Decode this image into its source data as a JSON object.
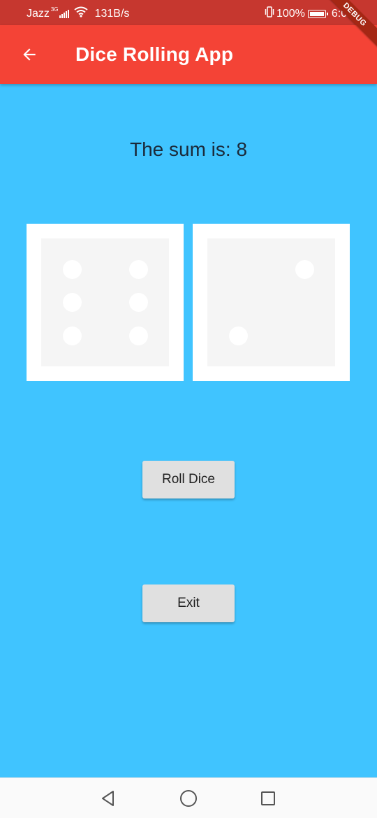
{
  "status_bar": {
    "carrier": "Jazz",
    "network_type": "3G",
    "speed": "131B/s",
    "battery": "100%",
    "time": "6:02",
    "icons": [
      "signal-icon",
      "wifi-icon",
      "vibrate-icon",
      "battery-icon"
    ]
  },
  "debug_banner": "DEBUG",
  "app_bar": {
    "title": "Dice Rolling App",
    "back_icon": "arrow-back-icon",
    "color": "#F44336"
  },
  "main": {
    "sum_text": "The sum is: 8",
    "dice": [
      {
        "name": "left-die",
        "value": 6
      },
      {
        "name": "right-die",
        "value": 2
      }
    ],
    "roll_button_label": "Roll Dice",
    "exit_button_label": "Exit",
    "background_color": "#40C4FF"
  },
  "nav_bar": {
    "icons": [
      "nav-back-icon",
      "nav-home-icon",
      "nav-recent-icon"
    ]
  }
}
